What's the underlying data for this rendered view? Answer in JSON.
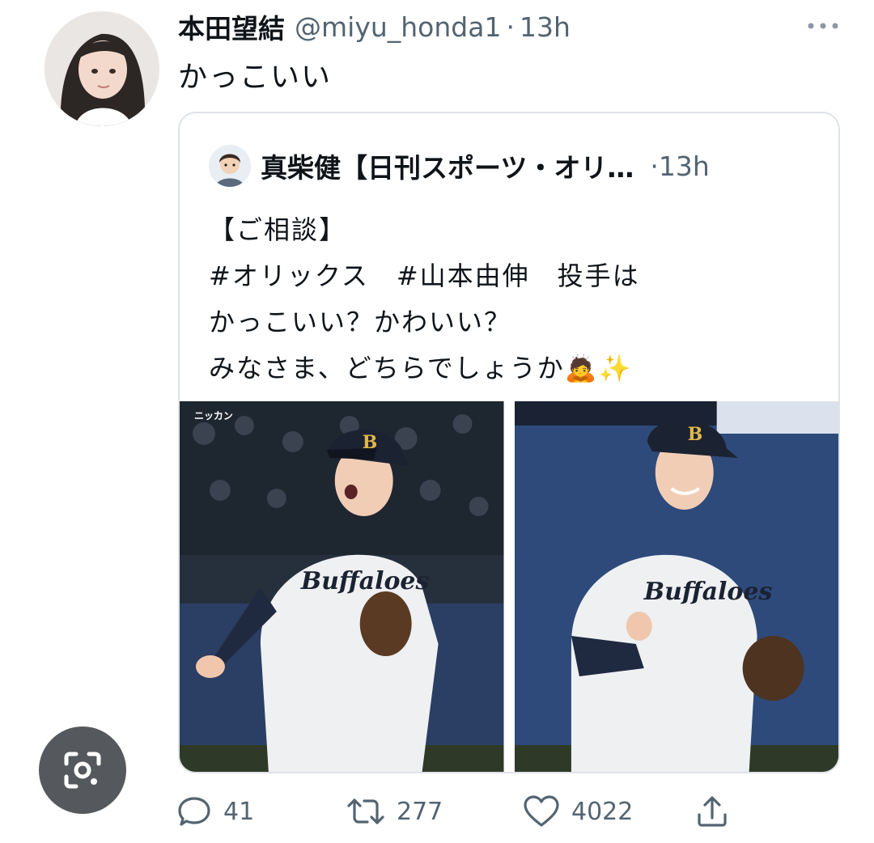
{
  "tweet": {
    "display_name": "本田望結",
    "handle": "@miyu_honda1",
    "separator": "·",
    "time": "13h",
    "text": "かっこいい",
    "avatar_icon": "user-photo-icon",
    "more_icon": "more-dots-icon"
  },
  "quoted_tweet": {
    "display_name": "真柴健【日刊スポーツ・オリ…",
    "separator": "·",
    "time": "13h",
    "avatar_icon": "user-illustration-icon",
    "lines": [
      "【ご相談】",
      "#オリックス　#山本由伸　投手は",
      "かっこいい？かわいい？",
      "みなさま、どちらでしょうか🙇✨"
    ],
    "media": [
      {
        "name": "pitcher-photo-left",
        "jersey_text": "Buffaloes",
        "watermark": "ニッカン"
      },
      {
        "name": "pitcher-photo-right",
        "jersey_text": "Buffaloes"
      }
    ]
  },
  "actions": {
    "reply_count": "41",
    "retweet_count": "277",
    "like_count": "4022",
    "reply_icon": "reply-icon",
    "retweet_icon": "retweet-icon",
    "like_icon": "heart-icon",
    "share_icon": "share-icon"
  },
  "overlay": {
    "lens_icon": "google-lens-icon"
  },
  "colors": {
    "text_primary": "#0f1419",
    "text_secondary": "#536471",
    "border": "#dfe3e8",
    "lens_bg": "#55585c"
  }
}
